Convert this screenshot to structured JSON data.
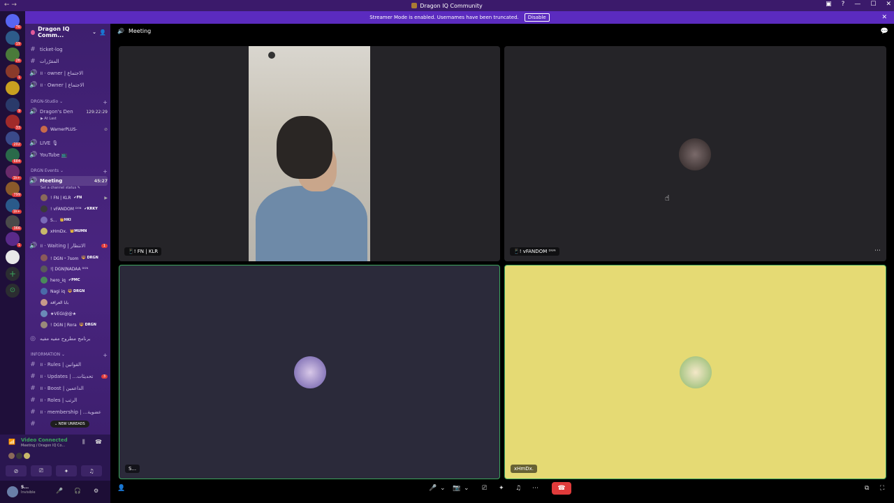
{
  "window": {
    "title": "Dragon IQ Community"
  },
  "banner": {
    "text": "Streamer Mode is enabled. Usernames have been truncated.",
    "disable_label": "Disable"
  },
  "server": {
    "name": "Dragon IQ Comm..."
  },
  "channels_top": [
    {
      "name": "ticket-log"
    },
    {
      "name": "المقرّرات"
    },
    {
      "name": "॥ · owner | الاجتماع"
    },
    {
      "name": "॥ · Owner | الاجتماع"
    }
  ],
  "cat_studio": "DRGN-Studio ⌄",
  "dragons_den": {
    "name": "Dragon's Den",
    "time": "129:22:29",
    "status": "▶ At Last",
    "user": "WarnerPLUS-"
  },
  "live": {
    "name": "LIVE 🎙"
  },
  "youtube": {
    "name": "YouTube 📺"
  },
  "cat_events": "DRGN Events ⌄",
  "meeting": {
    "name": "Meeting",
    "time": "45:27",
    "status": "Set a channel status ✎"
  },
  "meeting_users": [
    {
      "name": "! FN | KLR",
      "tag": "✔FN"
    },
    {
      "name": "! vFANDOM ᴰᴳᴺ",
      "tag": "✔KRKY"
    },
    {
      "name": "S...",
      "tag": "👑HKI"
    },
    {
      "name": "xHmDx.",
      "tag": "👑MUMN"
    }
  ],
  "waiting": {
    "name": "॥ · Waiting | الانتظار",
    "badge": "1"
  },
  "waiting_users": [
    {
      "name": "! DGN・7som",
      "tag": "🔱 DRGN"
    },
    {
      "name": "!| DGN|NADAA ᴰᴳᴺ",
      "tag": ""
    },
    {
      "name": "hero_iq",
      "tag": "✔PMC"
    },
    {
      "name": "Nagi iq",
      "tag": "🔱 DRGN"
    },
    {
      "name": "بابا العراقة",
      "tag": ""
    },
    {
      "name": "★VEGI@@★",
      "tag": ""
    },
    {
      "name": "! DGN | Rora",
      "tag": "🔱 DRGN"
    }
  ],
  "program": {
    "name": "برنامج مطروح مفيه مفيه"
  },
  "cat_info": "INFORMATION ⌄",
  "info_channels": [
    {
      "name": "॥ · Rules | القوانين"
    },
    {
      "name": "॥ · Updates | ...تحديثات",
      "badge": "3"
    },
    {
      "name": "॥ · Boost | الداعمين"
    },
    {
      "name": "॥ · Roles | الرتب"
    },
    {
      "name": "॥ · membership | ...عضوية"
    }
  ],
  "new_unreads": "⌄ NEW UNREADS",
  "voice": {
    "status": "Video Connected",
    "location": "Meeting / Dragon IQ Co..."
  },
  "user": {
    "name": "S...",
    "status": "Invisible"
  },
  "main": {
    "channel": "Meeting"
  },
  "tiles": [
    {
      "label": "📱! FN | KLR"
    },
    {
      "label": "📱! vFANDOM ᴰᴳᴺ"
    },
    {
      "label": "S..."
    },
    {
      "label": "xHmDx."
    }
  ],
  "colors": {
    "accent": "#5b2bbf",
    "green": "#3ba55d",
    "red": "#e03b3b",
    "tile_yellow": "#e5da74"
  }
}
